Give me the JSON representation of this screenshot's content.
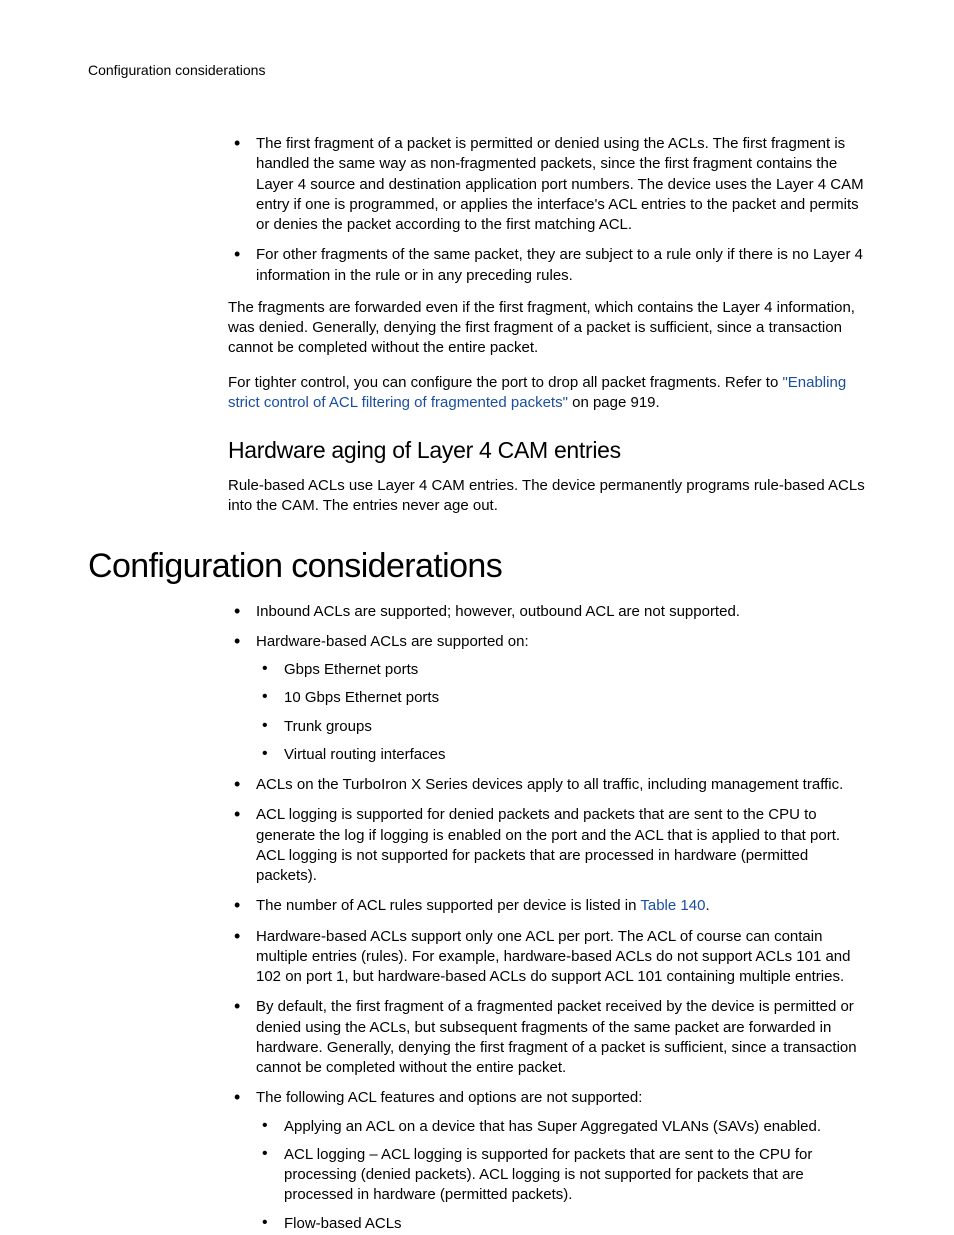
{
  "running_header": "Configuration considerations",
  "frag": {
    "b1": "The first fragment of a packet is permitted or denied using the ACLs.  The first fragment is handled the same way as non-fragmented packets, since the first fragment contains the Layer 4 source and destination application port numbers.  The device uses the Layer 4 CAM entry if one is programmed, or applies the interface's ACL entries to the packet and permits or denies the packet according to the first matching ACL.",
    "b2": "For other fragments of the same packet, they are subject to a rule only if there is no Layer 4 information in the rule or in any preceding rules.",
    "p1": "The fragments are forwarded even if the first fragment, which contains the Layer 4 information, was denied. Generally, denying the first fragment of a packet is sufficient, since a transaction cannot be completed without the entire packet.",
    "p2_a": "For tighter control, you can configure the port to drop all packet fragments.  Refer to ",
    "p2_link": "\"Enabling strict control of ACL filtering of fragmented packets\"",
    "p2_b": " on page 919."
  },
  "aging": {
    "heading": "Hardware aging of Layer 4 CAM entries",
    "p1": "Rule-based ACLs use Layer 4 CAM entries.  The device permanently programs rule-based ACLs into the CAM.  The entries never age out."
  },
  "config": {
    "heading": "Configuration considerations",
    "b1": "Inbound ACLs are supported; however, outbound ACL are not supported.",
    "b2": "Hardware-based ACLs are supported on:",
    "b2_sub": {
      "s1": "Gbps Ethernet ports",
      "s2": "10 Gbps Ethernet ports",
      "s3": "Trunk groups",
      "s4": "Virtual routing interfaces"
    },
    "b3": "ACLs on the TurboIron X Series devices apply to all traffic, including management traffic.",
    "b4": "ACL logging is supported for denied packets and packets that are sent to the CPU to generate the log if logging is enabled on the port and the ACL that is applied to that port.  ACL logging is not supported for packets that are processed in hardware (permitted packets).",
    "b5_a": "The number of ACL rules supported per device is listed in ",
    "b5_link": "Table 140",
    "b5_b": ".",
    "b6": "Hardware-based ACLs support only one ACL per port.  The ACL of course can contain multiple entries (rules).  For example, hardware-based ACLs do not support ACLs 101 and 102 on port 1, but hardware-based ACLs do support ACL 101 containing multiple entries.",
    "b7": "By default, the first fragment of a fragmented packet received by the device is permitted or denied using the ACLs, but subsequent fragments of the same packet are forwarded in hardware.  Generally, denying the first fragment of a packet is sufficient, since a transaction cannot be completed without the entire packet.",
    "b8": "The following ACL features and options are not supported:",
    "b8_sub": {
      "s1": "Applying an ACL on a device that has Super Aggregated VLANs (SAVs) enabled.",
      "s2": "ACL logging – ACL logging is supported for packets that are sent to the CPU for processing (denied packets).  ACL logging is not supported for packets that are processed in hardware (permitted packets).",
      "s3": "Flow-based ACLs"
    }
  }
}
